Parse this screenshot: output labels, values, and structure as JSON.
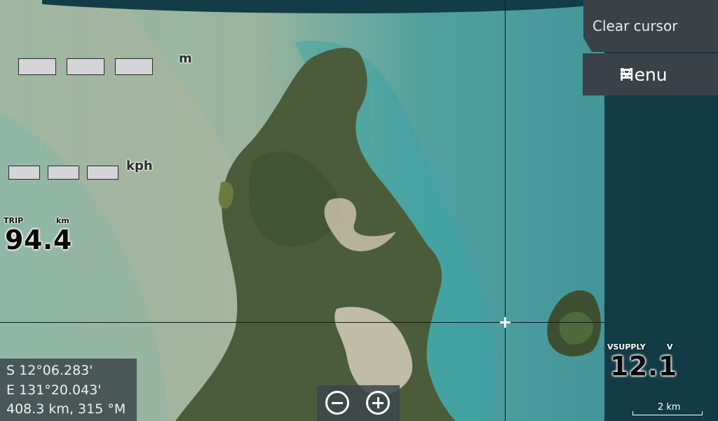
{
  "actions": {
    "clear_cursor_label": "Clear cursor",
    "menu_label": "Menu"
  },
  "depth_gauge": {
    "unit": "m"
  },
  "speed_gauge": {
    "unit": "kph"
  },
  "trip": {
    "label": "TRIP",
    "unit": "km",
    "value": "94.4"
  },
  "vsupply": {
    "label": "VSUPPLY",
    "unit": "V",
    "value": "12.1"
  },
  "cursor_position": {
    "latitude": "S  12°06.283'",
    "longitude": "E 131°20.043'",
    "range_bearing": "408.3 km, 315 °M"
  },
  "scale": {
    "label": "2 km"
  },
  "colors": {
    "water": "#6ea89f",
    "land": "#4a5a38",
    "panel": "#3a4247",
    "sidebar": "#082834"
  }
}
